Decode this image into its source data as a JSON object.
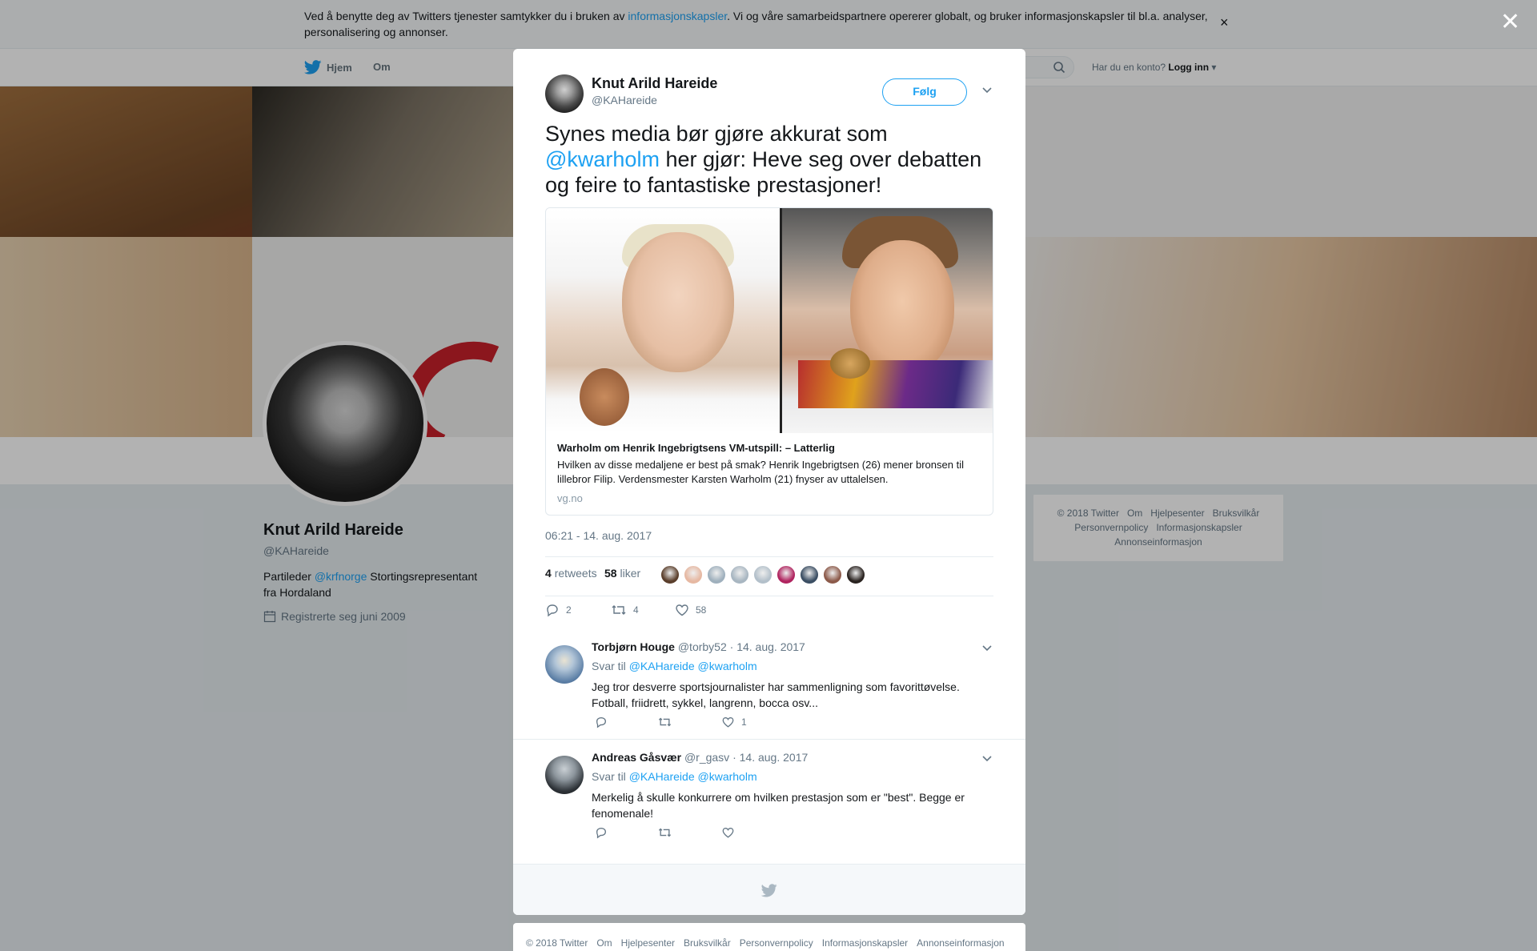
{
  "cookie": {
    "text_before": "Ved å benytte deg av Twitters tjenester samtykker du i bruken av ",
    "link": "informasjonskapsler",
    "text_after": ". Vi og våre samarbeidspartnere opererer globalt, og bruker informasjonskapsler til bl.a. analyser, personalisering og annonser.",
    "close": "×"
  },
  "nav": {
    "home": "Hjem",
    "about": "Om",
    "login_prompt": "Har du en konto?",
    "login": "Logg inn"
  },
  "profile": {
    "name": "Knut Arild Hareide",
    "handle": "@KAHareide",
    "bio_before": "Partileder ",
    "bio_link": "@krfnorge",
    "bio_after": " Stortingsrepresentant fra Hordaland",
    "joined": "Registrerte seg juni 2009"
  },
  "side_footer": {
    "links": [
      "© 2018 Twitter",
      "Om",
      "Hjelpesenter",
      "Bruksvilkår",
      "Personvernpolicy",
      "Informasjonskapsler",
      "Annonseinformasjon"
    ]
  },
  "overlay_close": "✕",
  "tweet": {
    "name": "Knut Arild Hareide",
    "handle": "@KAHareide",
    "follow": "Følg",
    "text_before": "Synes media bør gjøre akkurat som ",
    "mention": "@kwarholm",
    "text_after": " her gjør: Heve seg over debatten og feire to fantastiske prestasjoner!",
    "card": {
      "title": "Warholm om Henrik Ingebrigtsens VM-utspill: – Latterlig",
      "description": "Hvilken av disse medaljene er best på smak? Henrik Ingebrigtsen (26) mener bronsen til lillebror Filip. Verdensmester Karsten Warholm (21) fnyser av uttalelsen.",
      "domain": "vg.no"
    },
    "time": "06:21 - 14. aug. 2017",
    "retweets_count": "4",
    "retweets_label": "retweets",
    "likes_count": "58",
    "likes_label": "liker",
    "liker_colors": [
      "#5a3e2b",
      "#e6b8a2",
      "#9fb0bd",
      "#a8b6c1",
      "#b3c0ca",
      "#b0245f",
      "#3b4e63",
      "#8c5a4a",
      "#2a2320"
    ],
    "actions": {
      "replies": "2",
      "retweets": "4",
      "likes": "58"
    }
  },
  "replies": [
    {
      "name": "Torbjørn Houge",
      "handle": "@torby52",
      "date": "· 14. aug. 2017",
      "reply_to_label": "Svar til",
      "reply_to": "@KAHareide @kwarholm",
      "text": "Jeg tror desverre sportsjournalister har sammenligning som favorittøvelse. Fotball, friidrett, sykkel, langrenn, bocca osv...",
      "likes": "1",
      "avatar_color": "#6b8fb3"
    },
    {
      "name": "Andreas Gåsvær",
      "handle": "@r_gasv",
      "date": "· 14. aug. 2017",
      "reply_to_label": "Svar til",
      "reply_to": "@KAHareide @kwarholm",
      "text": "Merkelig å skulle konkurrere om hvilken prestasjon som er \"best\". Begge er fenomenale!",
      "likes": "",
      "avatar_color": "#3a3f44"
    }
  ],
  "bottom_footer": {
    "links": [
      "© 2018 Twitter",
      "Om",
      "Hjelpesenter",
      "Bruksvilkår",
      "Personvernpolicy",
      "Informasjonskapsler",
      "Annonseinformasjon"
    ]
  },
  "colors": {
    "accent": "#1da1f2",
    "text": "#14171a",
    "muted": "#657786"
  }
}
